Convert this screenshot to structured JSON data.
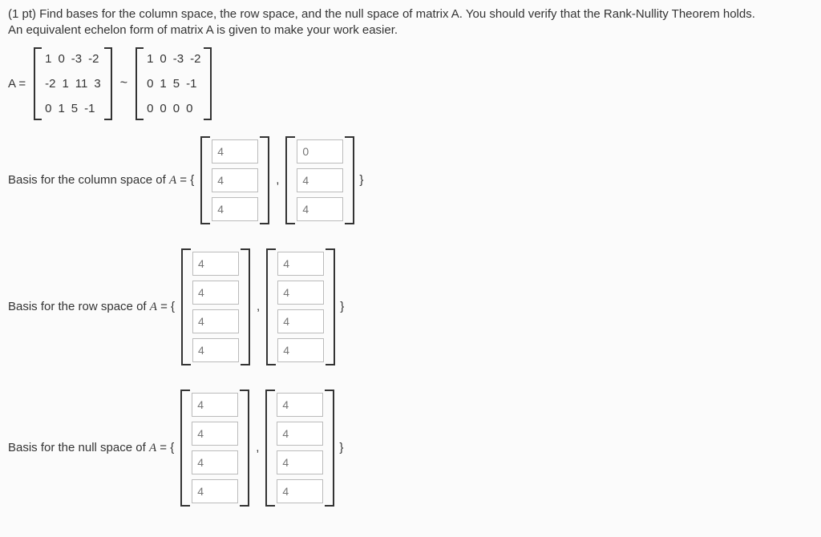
{
  "problem": {
    "line1": "(1 pt) Find bases for the column space, the row space, and the null space of matrix A. You should verify that the Rank-Nullity Theorem holds.",
    "line2": "An equivalent echelon form of matrix A is given to make your work easier."
  },
  "matrixA": {
    "label": "A =",
    "rows": [
      [
        "1",
        "0",
        "-3",
        "-2"
      ],
      [
        "-2",
        "1",
        "11",
        "3"
      ],
      [
        "0",
        "1",
        "5",
        "-1"
      ]
    ]
  },
  "tilde": "~",
  "echelon": {
    "rows": [
      [
        "1",
        "0",
        "-3",
        "-2"
      ],
      [
        "0",
        "1",
        "5",
        "-1"
      ],
      [
        "0",
        "0",
        "0",
        "0"
      ]
    ]
  },
  "placeholder": "4",
  "zero_placeholder": "0",
  "sections": {
    "col": {
      "label_prefix": "Basis for the column space of ",
      "label_A": "A",
      "label_suffix": " = {",
      "close": "}",
      "vec1": [
        "4",
        "4",
        "4"
      ],
      "vec2": [
        "0",
        "4",
        "4"
      ]
    },
    "row": {
      "label_prefix": "Basis for the row space of ",
      "label_A": "A",
      "label_suffix": " = {",
      "close": "}",
      "vec1": [
        "4",
        "4",
        "4",
        "4"
      ],
      "vec2": [
        "4",
        "4",
        "4",
        "4"
      ]
    },
    "null": {
      "label_prefix": "Basis for the null space of ",
      "label_A": "A",
      "label_suffix": " = {",
      "close": "}",
      "vec1": [
        "4",
        "4",
        "4",
        "4"
      ],
      "vec2": [
        "4",
        "4",
        "4",
        "4"
      ]
    }
  },
  "comma": ","
}
